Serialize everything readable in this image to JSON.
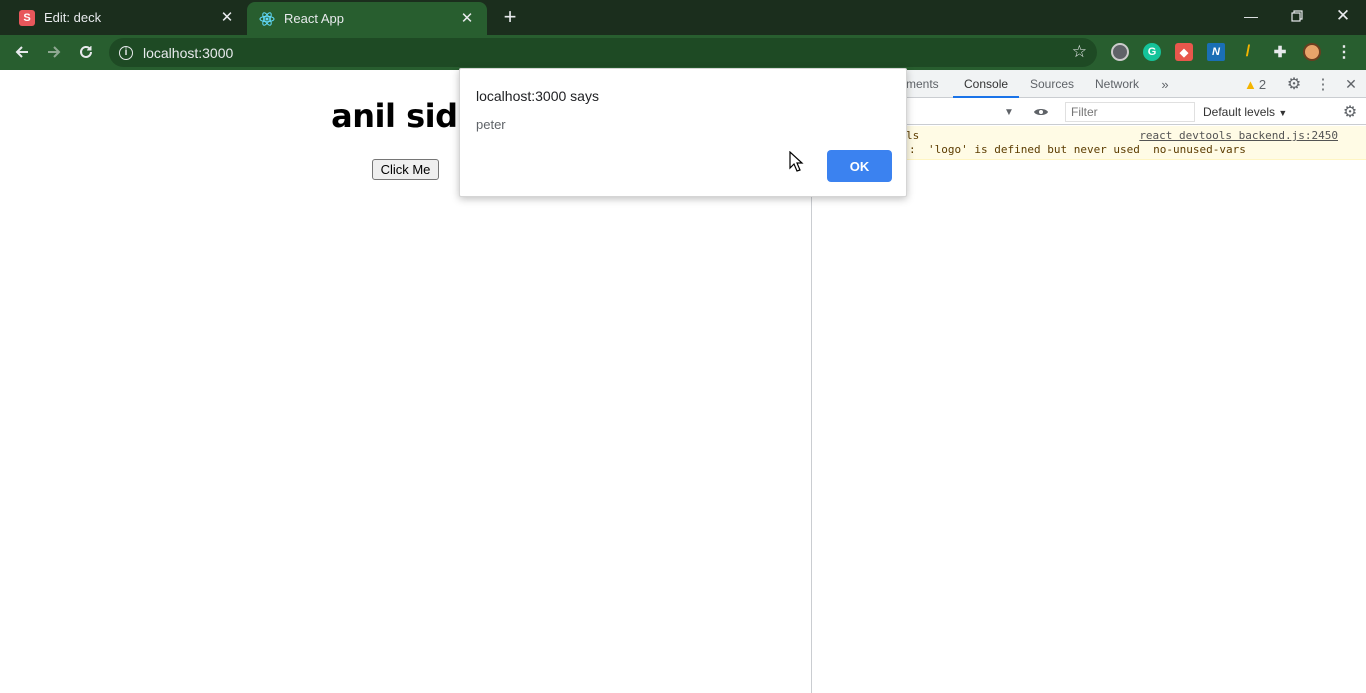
{
  "browser": {
    "tabs": [
      {
        "label": "Edit: deck",
        "favicon": "S",
        "active": false
      },
      {
        "label": "React App",
        "favicon": "react-icon",
        "active": true
      }
    ],
    "address": "localhost:3000",
    "colors": {
      "frame": "#1b2e1d",
      "toolbar": "#285e2f"
    }
  },
  "page": {
    "heading": "anil sidh",
    "button_label": "Click Me"
  },
  "devtools": {
    "tabs": [
      "ments",
      "Console",
      "Sources",
      "Network"
    ],
    "selected_tab": "Console",
    "warning_count": "2",
    "filter_placeholder": "Filter",
    "levels": "Default levels",
    "messages": [
      {
        "prefix": "ls",
        "link": "react devtools backend.js:2450"
      },
      {
        "prefix": ":",
        "text": "'logo' is defined but never used  no-unused-vars"
      }
    ]
  },
  "dialog": {
    "title": "localhost:3000 says",
    "message": "peter",
    "ok_label": "OK",
    "ok_color": "#3b82f0"
  }
}
